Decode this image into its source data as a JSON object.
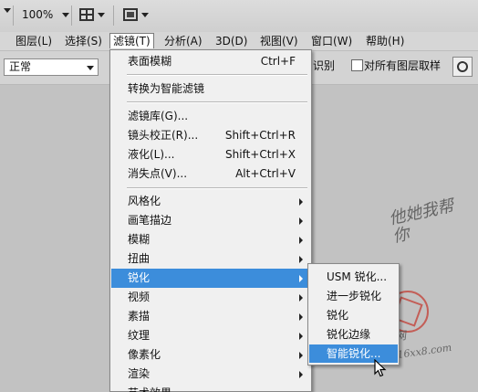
{
  "toolbar": {
    "zoom": "100%"
  },
  "menubar": {
    "items": [
      "图层(L)",
      "选择(S)",
      "滤镜(T)",
      "分析(A)",
      "3D(D)",
      "视图(V)",
      "窗口(W)",
      "帮助(H)"
    ],
    "active": "滤镜(T)"
  },
  "options": {
    "mode": "正常",
    "truncated_label": "识别",
    "sample_all_layers": "对所有图层取样"
  },
  "filter_menu": {
    "items": [
      {
        "label": "表面模糊",
        "shortcut": "Ctrl+F"
      },
      {
        "label": "转换为智能滤镜"
      },
      {
        "label": "滤镜库(G)..."
      },
      {
        "label": "镜头校正(R)...",
        "shortcut": "Shift+Ctrl+R"
      },
      {
        "label": "液化(L)...",
        "shortcut": "Shift+Ctrl+X"
      },
      {
        "label": "消失点(V)...",
        "shortcut": "Alt+Ctrl+V"
      },
      {
        "label": "风格化"
      },
      {
        "label": "画笔描边"
      },
      {
        "label": "模糊"
      },
      {
        "label": "扭曲"
      },
      {
        "label": "锐化"
      },
      {
        "label": "视频"
      },
      {
        "label": "素描"
      },
      {
        "label": "纹理"
      },
      {
        "label": "像素化"
      },
      {
        "label": "渲染"
      },
      {
        "label": "艺术效果"
      }
    ]
  },
  "sharpen_submenu": {
    "items": [
      "USM 锐化...",
      "进一步锐化",
      "锐化",
      "锐化边缘",
      "智能锐化..."
    ],
    "highlighted": "智能锐化..."
  },
  "watermark": {
    "line1": "他她我帮你",
    "line2": "PS教程网",
    "line3": "www.16xx8.com",
    "seal_color": "#c4342a"
  },
  "colors": {
    "highlight": "#3c8ddb",
    "menu_bg": "#f0f0f0"
  }
}
